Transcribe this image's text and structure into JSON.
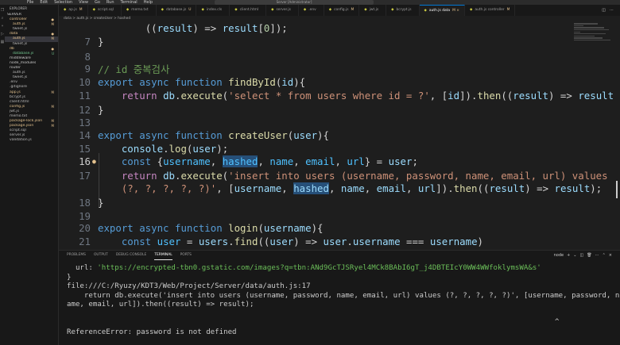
{
  "menu": [
    "File",
    "Edit",
    "Selection",
    "View",
    "Go",
    "Run",
    "Terminal",
    "Help"
  ],
  "command_center": "Server [Administrator]",
  "sidebar": {
    "title": "EXPLORER",
    "root": "SERVER",
    "items": [
      {
        "label": "controller",
        "badge": "●"
      },
      {
        "label": "auth.js",
        "badge": "M"
      },
      {
        "label": "tweet.js",
        "badge": ""
      },
      {
        "label": "data",
        "badge": "●"
      },
      {
        "label": "auth.js",
        "badge": "M"
      },
      {
        "label": "tweet.js",
        "badge": ""
      },
      {
        "label": "db",
        "badge": "●"
      },
      {
        "label": "database.js",
        "badge": "U"
      },
      {
        "label": "middleware",
        "badge": ""
      },
      {
        "label": "node_modules",
        "badge": ""
      },
      {
        "label": "router",
        "badge": ""
      },
      {
        "label": "auth.js",
        "badge": ""
      },
      {
        "label": "tweet.js",
        "badge": ""
      },
      {
        "label": ".env",
        "badge": ""
      },
      {
        "label": ".gitignore",
        "badge": ""
      },
      {
        "label": "app.js",
        "badge": "M"
      },
      {
        "label": "bcrypt.js",
        "badge": ""
      },
      {
        "label": "client.html",
        "badge": ""
      },
      {
        "label": "config.js",
        "badge": "M"
      },
      {
        "label": "jwt.js",
        "badge": ""
      },
      {
        "label": "memo.txt",
        "badge": ""
      },
      {
        "label": "package-lock.json",
        "badge": "M"
      },
      {
        "label": "package.json",
        "badge": "M"
      },
      {
        "label": "script.sql",
        "badge": ""
      },
      {
        "label": "server.js",
        "badge": ""
      },
      {
        "label": "validation.js",
        "badge": ""
      }
    ]
  },
  "tabs": [
    {
      "label": "ap.js",
      "mod": "M"
    },
    {
      "label": "script.sql",
      "mod": ""
    },
    {
      "label": "memo.txt",
      "mod": ""
    },
    {
      "label": "database.js",
      "mod": "U"
    },
    {
      "label": "index.cls",
      "mod": ""
    },
    {
      "label": "client.html",
      "mod": ""
    },
    {
      "label": "server.js",
      "mod": ""
    },
    {
      "label": ".env",
      "mod": ""
    },
    {
      "label": "config.js",
      "mod": "M"
    },
    {
      "label": "jwt.js",
      "mod": ""
    },
    {
      "label": "bcrypt.js",
      "mod": ""
    },
    {
      "label": "auth.js data",
      "mod": "M ×"
    },
    {
      "label": "auth.js controller",
      "mod": "M"
    }
  ],
  "breadcrumb": "data > auth.js > createUser > hashed",
  "editor": {
    "lines": [
      {
        "n": "",
        "tokens": [
          [
            "        ",
            ""
          ],
          [
            "((",
            ""
          ],
          [
            "result",
            "vr"
          ],
          [
            ") => ",
            ""
          ],
          [
            "result",
            "vr"
          ],
          [
            "[",
            ""
          ],
          [
            "0",
            "nm"
          ],
          [
            "]);",
            ""
          ]
        ]
      },
      {
        "n": "7",
        "tokens": [
          [
            "}",
            ""
          ]
        ]
      },
      {
        "n": "8",
        "tokens": []
      },
      {
        "n": "9",
        "tokens": [
          [
            "// id 중복검사",
            "cm"
          ]
        ]
      },
      {
        "n": "10",
        "tokens": [
          [
            "export ",
            "kw"
          ],
          [
            "async ",
            "kw"
          ],
          [
            "function ",
            "kw"
          ],
          [
            "findById",
            "fn"
          ],
          [
            "(",
            ""
          ],
          [
            "id",
            "vr"
          ],
          [
            "){",
            ""
          ]
        ]
      },
      {
        "n": "11",
        "tokens": [
          [
            "    ",
            ""
          ],
          [
            "return ",
            "kw2"
          ],
          [
            "db",
            "vr"
          ],
          [
            ".",
            ""
          ],
          [
            "execute",
            "fn"
          ],
          [
            "(",
            ""
          ],
          [
            "'select * from users where id = ?'",
            "st"
          ],
          [
            ", [",
            ""
          ],
          [
            "id",
            "vr"
          ],
          [
            "]).",
            ""
          ],
          [
            "then",
            "fn"
          ],
          [
            "((",
            ""
          ],
          [
            "result",
            "vr"
          ],
          [
            ") => ",
            ""
          ],
          [
            "result",
            "vr"
          ],
          [
            ");",
            ""
          ]
        ]
      },
      {
        "n": "12",
        "tokens": [
          [
            "}",
            ""
          ]
        ]
      },
      {
        "n": "13",
        "tokens": []
      },
      {
        "n": "14",
        "tokens": [
          [
            "export ",
            "kw"
          ],
          [
            "async ",
            "kw"
          ],
          [
            "function ",
            "kw"
          ],
          [
            "createUser",
            "fn"
          ],
          [
            "(",
            ""
          ],
          [
            "user",
            "vr"
          ],
          [
            "){",
            ""
          ]
        ]
      },
      {
        "n": "15",
        "tokens": [
          [
            "    ",
            ""
          ],
          [
            "console",
            "vr"
          ],
          [
            ".",
            ""
          ],
          [
            "log",
            "fn"
          ],
          [
            "(",
            ""
          ],
          [
            "user",
            "vr"
          ],
          [
            ");",
            ""
          ]
        ]
      },
      {
        "n": "16",
        "tokens": [
          [
            "    ",
            ""
          ],
          [
            "const ",
            "kw"
          ],
          [
            "{",
            ""
          ],
          [
            "username",
            "cn"
          ],
          [
            ", ",
            ""
          ],
          [
            "hashed",
            "cn hl"
          ],
          [
            ", ",
            ""
          ],
          [
            "name",
            "cn"
          ],
          [
            ", ",
            ""
          ],
          [
            "email",
            "cn"
          ],
          [
            ", ",
            ""
          ],
          [
            "url",
            "cn"
          ],
          [
            "} = ",
            ""
          ],
          [
            "user",
            "vr"
          ],
          [
            ";",
            ""
          ]
        ],
        "current": true
      },
      {
        "n": "17",
        "tokens": [
          [
            "    ",
            ""
          ],
          [
            "return ",
            "kw2"
          ],
          [
            "db",
            "vr"
          ],
          [
            ".",
            ""
          ],
          [
            "execute",
            "fn"
          ],
          [
            "(",
            ""
          ],
          [
            "'insert into users (username, password, name, email, url) values",
            "st"
          ]
        ]
      },
      {
        "n": "",
        "tokens": [
          [
            "    ",
            ""
          ],
          [
            "(?, ?, ?, ?, ?)'",
            "st"
          ],
          [
            ", [",
            ""
          ],
          [
            "username",
            "vr"
          ],
          [
            ", ",
            ""
          ],
          [
            "hashed",
            "vr hl"
          ],
          [
            ", ",
            ""
          ],
          [
            "name",
            "vr"
          ],
          [
            ", ",
            ""
          ],
          [
            "email",
            "vr"
          ],
          [
            ", ",
            ""
          ],
          [
            "url",
            "vr"
          ],
          [
            "]).",
            ""
          ],
          [
            "then",
            "fn"
          ],
          [
            "((",
            ""
          ],
          [
            "result",
            "vr"
          ],
          [
            ") => ",
            ""
          ],
          [
            "result",
            "vr"
          ],
          [
            ");",
            ""
          ]
        ]
      },
      {
        "n": "18",
        "tokens": [
          [
            "}",
            ""
          ]
        ]
      },
      {
        "n": "19",
        "tokens": []
      },
      {
        "n": "20",
        "tokens": [
          [
            "export ",
            "kw"
          ],
          [
            "async ",
            "kw"
          ],
          [
            "function ",
            "kw"
          ],
          [
            "login",
            "fn"
          ],
          [
            "(",
            ""
          ],
          [
            "username",
            "vr"
          ],
          [
            "){",
            ""
          ]
        ]
      },
      {
        "n": "21",
        "tokens": [
          [
            "    ",
            ""
          ],
          [
            "const ",
            "kw"
          ],
          [
            "user",
            "cn"
          ],
          [
            " = ",
            ""
          ],
          [
            "users",
            "vr"
          ],
          [
            ".",
            ""
          ],
          [
            "find",
            "fn"
          ],
          [
            "((",
            ""
          ],
          [
            "user",
            "vr"
          ],
          [
            ") => ",
            ""
          ],
          [
            "user",
            "vr"
          ],
          [
            ".",
            ""
          ],
          [
            "username",
            "vr"
          ],
          [
            " === ",
            ""
          ],
          [
            "username",
            "vr"
          ],
          [
            ")",
            ""
          ]
        ]
      }
    ]
  },
  "panel": {
    "tabs": [
      "PROBLEMS",
      "OUTPUT",
      "DEBUG CONSOLE",
      "TERMINAL",
      "PORTS"
    ],
    "active_tab": "TERMINAL",
    "shell": "node",
    "terminal": {
      "url_key": "  url: ",
      "url_val": "'https://encrypted-tbn0.gstatic.com/images?q=tbn:ANd9GcTJSRyel4MCk8BAbI6gT_j4DBTEIcY0WW4WWfoklymsWA&s'",
      "l2": "}",
      "l3": "file:///C:/Ryuzy/KDT3/Web/Project/Server/data/auth.js:17",
      "l4": "    return db.execute('insert into users (username, password, name, email, url) values (?, ?, ?, ?, ?)', [username, password, n",
      "l5": "ame, email, url]).then((result) => result);",
      "l6": "",
      "l7": "ReferenceError: password is not defined",
      "caret": "^"
    }
  }
}
